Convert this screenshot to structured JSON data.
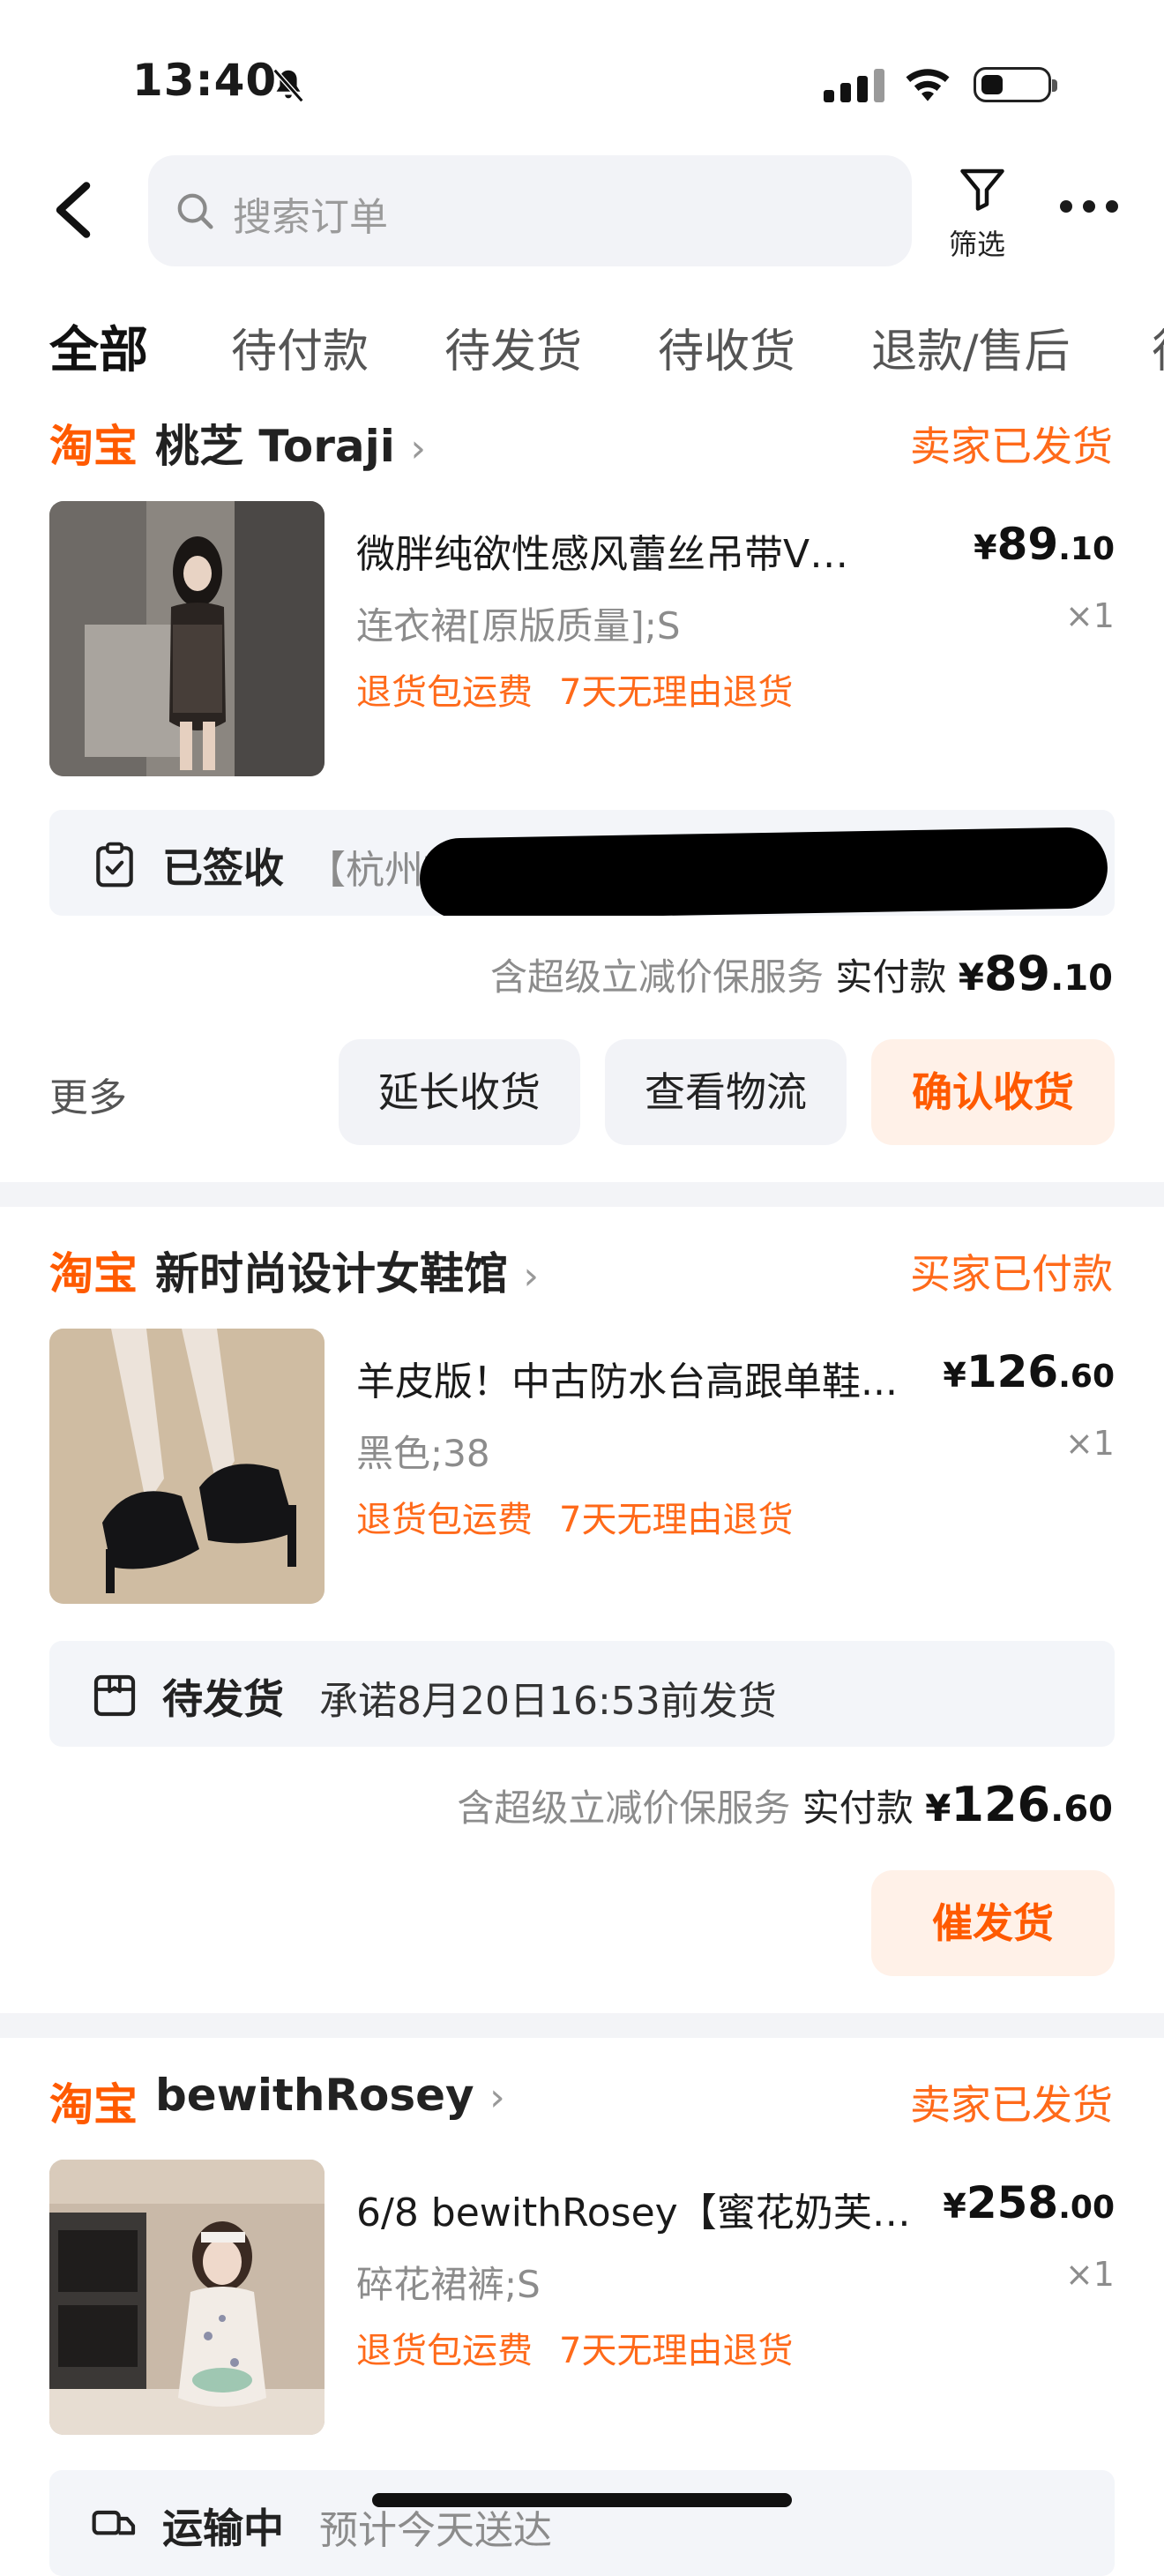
{
  "status_bar": {
    "time": "13:40"
  },
  "header": {
    "search_placeholder": "搜索订单",
    "filter_label": "筛选"
  },
  "tabs": [
    "全部",
    "待付款",
    "待发货",
    "待收货",
    "退款/售后",
    "待"
  ],
  "orders": [
    {
      "platform": "淘宝",
      "shop": "桃芝 Toraji",
      "status": "卖家已发货",
      "title": "微胖纯欲性感风蕾丝吊带V领包...",
      "price_symbol": "¥",
      "price_int": "89",
      "price_dec": ".10",
      "spec": "连衣裙[原版质量];S",
      "qty": "×1",
      "tags": [
        "退货包运费",
        "7天无理由退货"
      ],
      "logistics_status": "已签收",
      "logistics_detail": "【杭州市】快件...",
      "total_note": "含超级立减价保服务",
      "total_label": "实付款",
      "total_int": "89",
      "total_dec": ".10",
      "more": "更多",
      "buttons": [
        "延长收货",
        "查看物流",
        "确认收货"
      ]
    },
    {
      "platform": "淘宝",
      "shop": "新时尚设计女鞋馆",
      "status": "买家已付款",
      "title": "羊皮版！中古防水台高跟单鞋...",
      "price_symbol": "¥",
      "price_int": "126",
      "price_dec": ".60",
      "spec": "黑色;38",
      "qty": "×1",
      "tags": [
        "退货包运费",
        "7天无理由退货"
      ],
      "logistics_status": "待发货",
      "logistics_detail": "承诺8月20日16:53前发货",
      "total_note": "含超级立减价保服务",
      "total_label": "实付款",
      "total_int": "126",
      "total_dec": ".60",
      "buttons": [
        "催发货"
      ]
    },
    {
      "platform": "淘宝",
      "shop": "bewithRosey",
      "status": "卖家已发货",
      "title": "6/8 bewithRosey【蜜花奶芙】...",
      "price_symbol": "¥",
      "price_int": "258",
      "price_dec": ".00",
      "spec": "碎花裙裤;S",
      "qty": "×1",
      "tags": [
        "退货包运费",
        "7天无理由退货"
      ],
      "logistics_status": "运输中",
      "logistics_detail": "预计今天送达"
    }
  ]
}
